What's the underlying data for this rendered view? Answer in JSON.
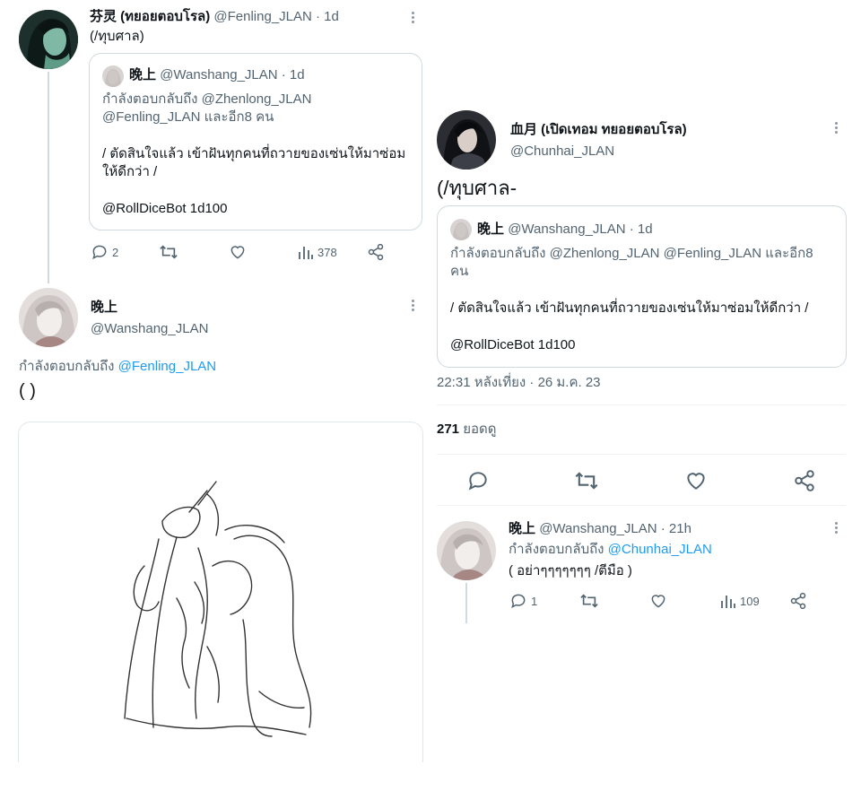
{
  "left": {
    "tweet1": {
      "display_name": "芬灵 (ทยอยตอบโรล)",
      "handle_time": "@Fenling_JLAN · 1d",
      "text": "(/ทุบศาล)",
      "quote": {
        "display_name": "晚上",
        "handle_time": "@Wanshang_JLAN · 1d",
        "reply_line1": "กำลังตอบกลับถึง @Zhenlong_JLAN",
        "reply_line2": "@Fenling_JLAN และอีก8 คน",
        "body_line1": "/ ตัดสินใจแล้ว เข้าฝันทุกคนที่ถวายของเซ่นให้มาซ่อม",
        "body_line2": "ให้ดีกว่า /",
        "body_line3": "@RollDiceBot 1d100"
      },
      "actions": {
        "reply_count": "2",
        "retweet_count": "",
        "like_count": "",
        "views_count": "378"
      }
    },
    "tweet2": {
      "display_name": "晚上",
      "handle": "@Wanshang_JLAN",
      "reply_prefix": "กำลังตอบกลับถึง",
      "reply_to": "@Fenling_JLAN",
      "text": "( )"
    }
  },
  "right": {
    "main_tweet": {
      "display_name": "血月 (เปิดเทอม ทยอยตอบโรล)",
      "handle": "@Chunhai_JLAN",
      "text": "(/ทุบศาล-",
      "quote": {
        "display_name": "晚上",
        "handle_time": "@Wanshang_JLAN · 1d",
        "reply_line1": "กำลังตอบกลับถึง @Zhenlong_JLAN @Fenling_JLAN และอีก8",
        "reply_line2": "คน",
        "body_line1": "/ ตัดสินใจแล้ว เข้าฝันทุกคนที่ถวายของเซ่นให้มาซ่อมให้ดีกว่า /",
        "body_line2": "@RollDiceBot 1d100"
      },
      "timestamp": "22:31 หลังเที่ยง · 26 ม.ค. 23",
      "views_number": "271",
      "views_label": "ยอดดู"
    },
    "reply": {
      "display_name": "晚上",
      "handle_time": "@Wanshang_JLAN · 21h",
      "reply_prefix": "กำลังตอบกลับถึง",
      "reply_to": "@Chunhai_JLAN",
      "text": "( อย่าๆๆๆๆๆๆๆ /ตีมือ )",
      "actions": {
        "reply_count": "1",
        "views_count": "109"
      }
    }
  },
  "colors": {
    "link": "#1d9bf0",
    "secondary_text": "#536471",
    "border": "#cfd9de"
  }
}
